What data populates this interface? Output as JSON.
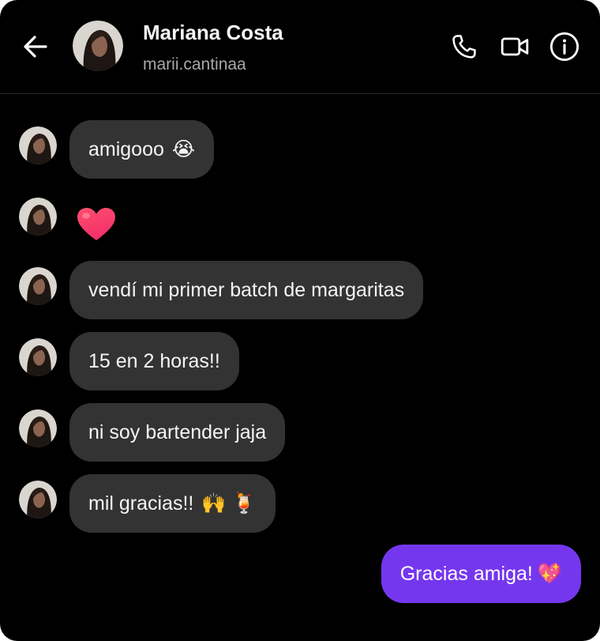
{
  "header": {
    "back_icon": "arrow-left-icon",
    "contact_name": "Mariana Costa",
    "contact_handle": "marii.cantinaa",
    "call_icon": "phone-icon",
    "video_icon": "video-camera-icon",
    "info_icon": "info-icon"
  },
  "messages": [
    {
      "from": "contact",
      "text": "amigooo",
      "emoji": "😭"
    },
    {
      "from": "contact",
      "text": "",
      "emoji": "❤️"
    },
    {
      "from": "contact",
      "text": "vendí mi primer batch de margaritas",
      "emoji": ""
    },
    {
      "from": "contact",
      "text": "15 en 2 horas!!",
      "emoji": ""
    },
    {
      "from": "contact",
      "text": "ni soy bartender jaja",
      "emoji": ""
    },
    {
      "from": "contact",
      "text": "mil gracias!!",
      "emoji": "🙌 🍹"
    },
    {
      "from": "me",
      "text": "Gracias amiga!",
      "emoji": "💖"
    }
  ],
  "colors": {
    "background": "#000000",
    "received_bubble": "#333333",
    "sent_bubble": "#7537ee",
    "handle_text": "#a8a8a8"
  }
}
